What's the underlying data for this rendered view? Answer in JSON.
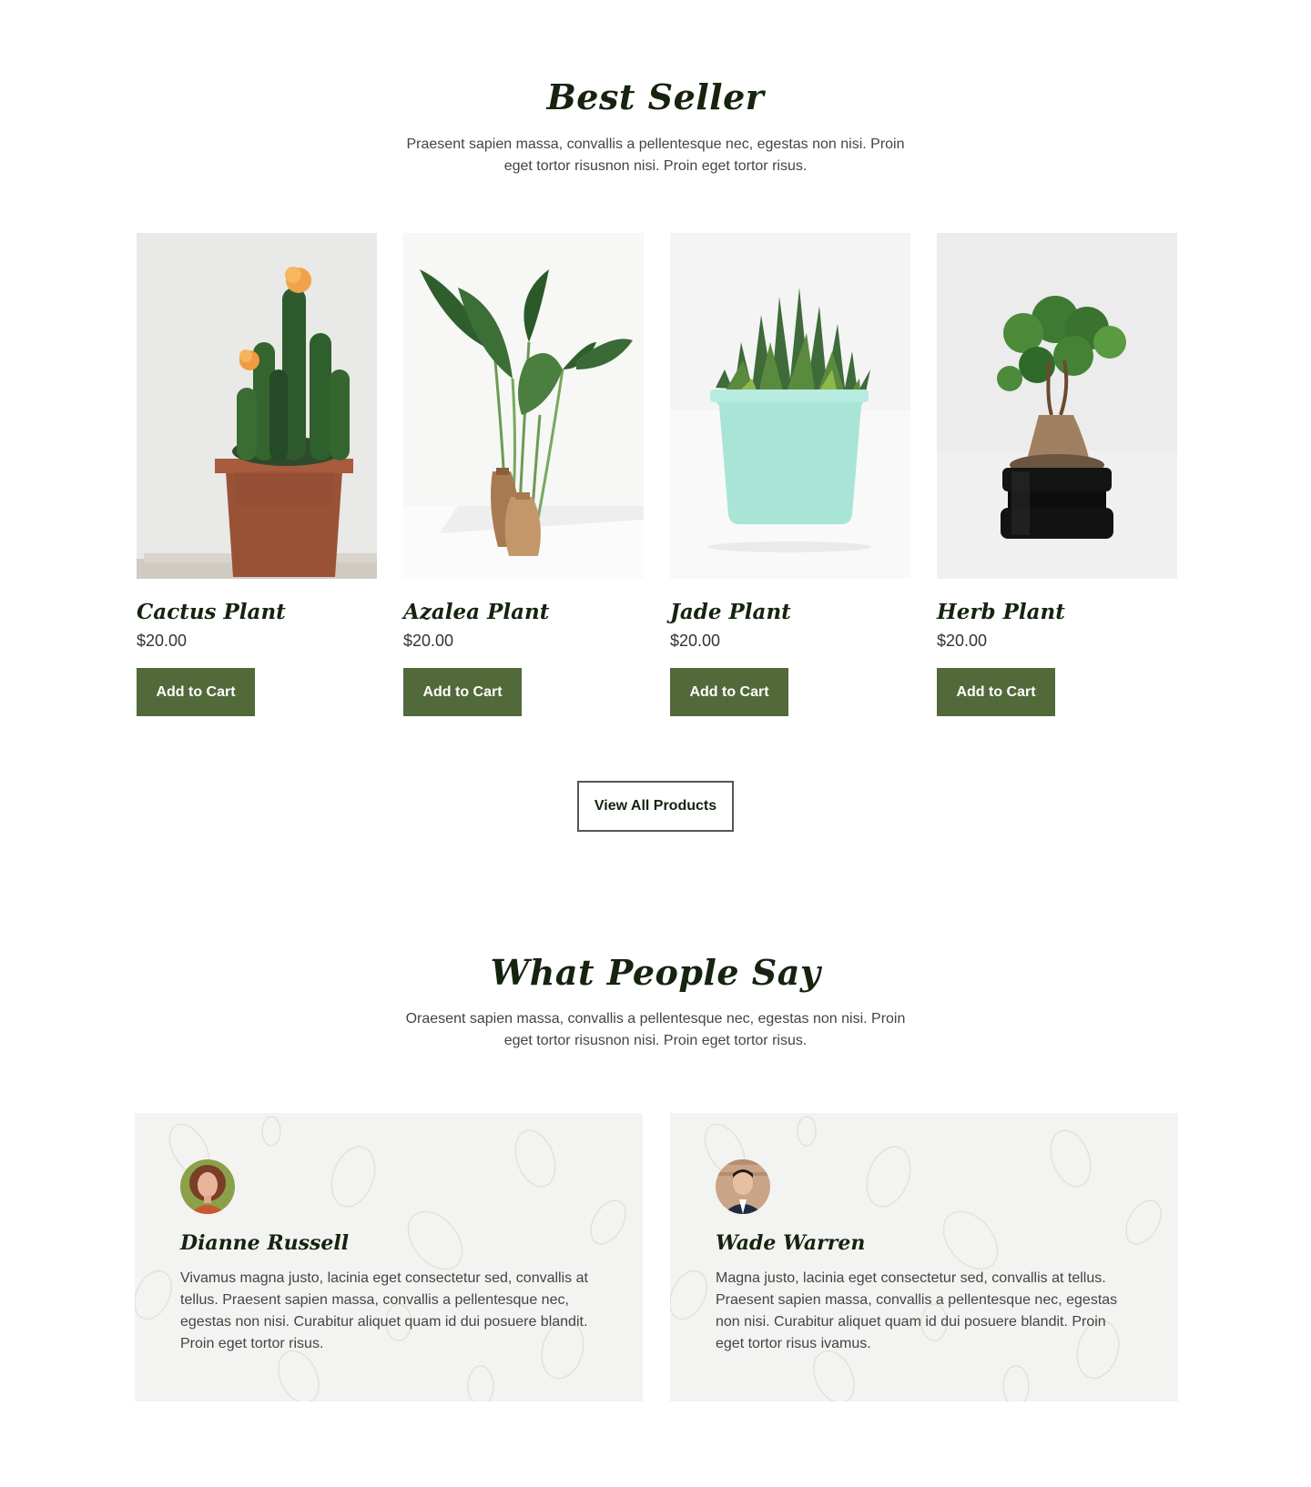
{
  "best_seller": {
    "title": "Best Seller",
    "subtitle": "Praesent sapien massa, convallis a pellentesque nec, egestas non nisi. Proin eget tortor risusnon nisi. Proin eget tortor risus."
  },
  "products": [
    {
      "name": "Cactus Plant",
      "price": "$20.00",
      "cta": "Add to Cart",
      "image": "cactus-in-terracotta-pot"
    },
    {
      "name": "Azalea Plant",
      "price": "$20.00",
      "cta": "Add to Cart",
      "image": "leafy-plant-in-wooden-vases"
    },
    {
      "name": "Jade Plant",
      "price": "$20.00",
      "cta": "Add to Cart",
      "image": "succulent-in-mint-pot"
    },
    {
      "name": "Herb Plant",
      "price": "$20.00",
      "cta": "Add to Cart",
      "image": "bonsai-in-black-pot"
    }
  ],
  "view_all_label": "View All Products",
  "testimonials_section": {
    "title": "What People Say",
    "subtitle": "Oraesent sapien massa, convallis a pellentesque nec, egestas non nisi. Proin eget tortor risusnon nisi. Proin eget tortor risus."
  },
  "testimonials": [
    {
      "name": "Dianne Russell",
      "quote": "Vivamus magna justo, lacinia eget consectetur sed, convallis at tellus. Praesent sapien massa, convallis a pellentesque nec, egestas non nisi. Curabitur aliquet quam id dui posuere blandit. Proin eget tortor risus."
    },
    {
      "name": "Wade Warren",
      "quote": "Magna justo, lacinia eget consectetur sed, convallis at tellus. Praesent sapien massa, convallis a pellentesque nec, egestas non nisi. Curabitur aliquet quam id dui posuere blandit. Proin eget tortor risus ivamus."
    }
  ],
  "colors": {
    "heading": "#15230f",
    "button_bg": "#52693a",
    "card_bg": "#f3f3f2"
  }
}
